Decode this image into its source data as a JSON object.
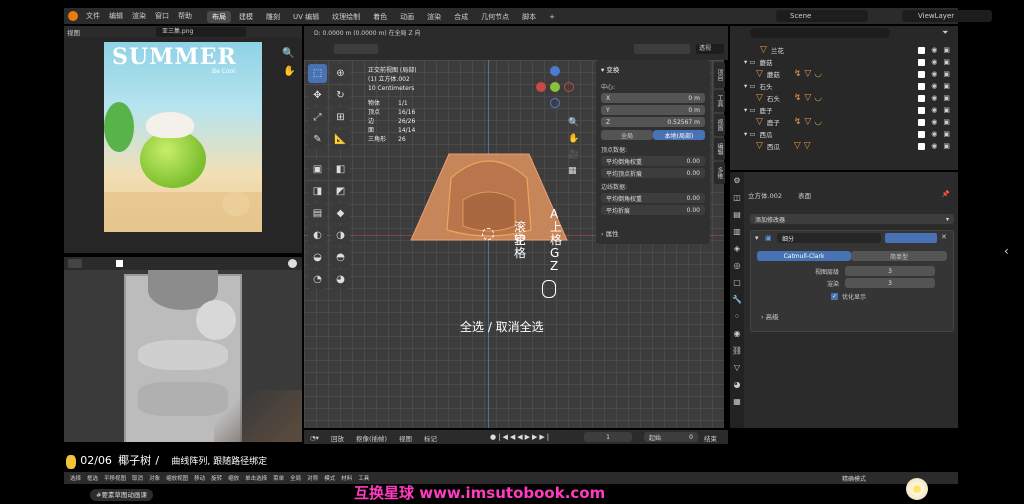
{
  "menubar": {
    "items": [
      "文件",
      "编辑",
      "渲染",
      "窗口",
      "帮助"
    ],
    "workspaces": [
      "布局",
      "建模",
      "雕刻",
      "UV 编辑",
      "纹理绘制",
      "着色",
      "动画",
      "渲染",
      "合成",
      "几何节点",
      "脚本"
    ],
    "active_workspace": "布局",
    "scene": "Scene",
    "view_layer": "ViewLayer"
  },
  "image_editor": {
    "header_label": "视图",
    "image_name": "亚三集.png",
    "poster_title": "SUMMER",
    "poster_subtitle": "Be Cool"
  },
  "viewport": {
    "header_text": "D: 0.0000 m (0.0000 m) 在全局 Z 向",
    "transform_mode": "透视",
    "view_title": "正交前视图 (局部)",
    "object_name": "(1) 立方体.002",
    "units": "10 Centimeters",
    "stats": [
      {
        "label": "物体",
        "value": "1/1"
      },
      {
        "label": "顶点",
        "value": "16/16"
      },
      {
        "label": "边",
        "value": "26/26"
      },
      {
        "label": "面",
        "value": "14/14"
      },
      {
        "label": "三角形",
        "value": "26"
      }
    ],
    "overlay_keys": [
      "A",
      "上",
      "格",
      "G",
      "Z"
    ],
    "overlay_scroll": "滚轮",
    "overlay_space": "空格",
    "select_all_text": "全选 / 取消全选"
  },
  "n_panel": {
    "section_transform": "变换",
    "median_label": "中心:",
    "x_label": "X",
    "x_value": "0 m",
    "y_label": "Y",
    "y_value": "0 m",
    "z_label": "Z",
    "z_value": "0.52567 m",
    "global_btn": "全局",
    "local_btn": "本地(局部)",
    "vertex_data": "顶点数据:",
    "mean_bevel": "平均倒角权重",
    "mean_bevel_value": "0.00",
    "mean_crease": "平均顶点折痕",
    "mean_crease_value": "0.00",
    "edge_data": "边线数据:",
    "edge_bevel": "平均倒角权重",
    "edge_bevel_value": "0.00",
    "edge_crease": "平均折痕",
    "edge_crease_value": "0.00",
    "section_props": "属性",
    "side_tabs": [
      "项目",
      "工具",
      "视图",
      "编辑",
      "多维"
    ]
  },
  "outliner": {
    "search_placeholder": "",
    "rows": [
      {
        "name": "兰花",
        "indent": 1
      },
      {
        "name": "蘑菇",
        "indent": 0
      },
      {
        "name": "蘑菇",
        "indent": 1
      },
      {
        "name": "石头",
        "indent": 0
      },
      {
        "name": "石头",
        "indent": 1
      },
      {
        "name": "鹿子",
        "indent": 0
      },
      {
        "name": "鹿子",
        "indent": 1
      },
      {
        "name": "西瓜",
        "indent": 0
      },
      {
        "name": "西瓜",
        "indent": 1
      }
    ]
  },
  "properties": {
    "object_name": "立方体.002",
    "modifier_tab": "表面",
    "add_modifier": "添加修改器",
    "modifier_name": "细分",
    "catmull_label": "Catmull-Clark",
    "simple_label": "简单型",
    "levels_label": "视图层级",
    "levels_value": "3",
    "render_label": "渲染",
    "render_value": "3",
    "optimal_label": "优化显示",
    "advanced_label": "高级"
  },
  "timeline": {
    "playback": "回放",
    "keying": "抠像(插帧)",
    "view": "视图",
    "marker": "标记",
    "current_frame": "1",
    "start_label": "起始",
    "start_value": "0",
    "end_label": "结束"
  },
  "subtitle": {
    "counter": "02/06",
    "name": "椰子树",
    "sep": "/",
    "line": "曲线阵列, 跟随路径绑定"
  },
  "statusbar": {
    "items": [
      "选择",
      "框选",
      "平移视图",
      "取消",
      "对象",
      "缩放视图",
      "移动",
      "旋转",
      "缩放",
      "单击选择",
      "菜单",
      "全局",
      "对称",
      "模式",
      "材料",
      "工具"
    ],
    "badge": "#要素草图动画课",
    "watermark": "互换星球 www.imsutobook.com",
    "right_label": "精确模式"
  }
}
